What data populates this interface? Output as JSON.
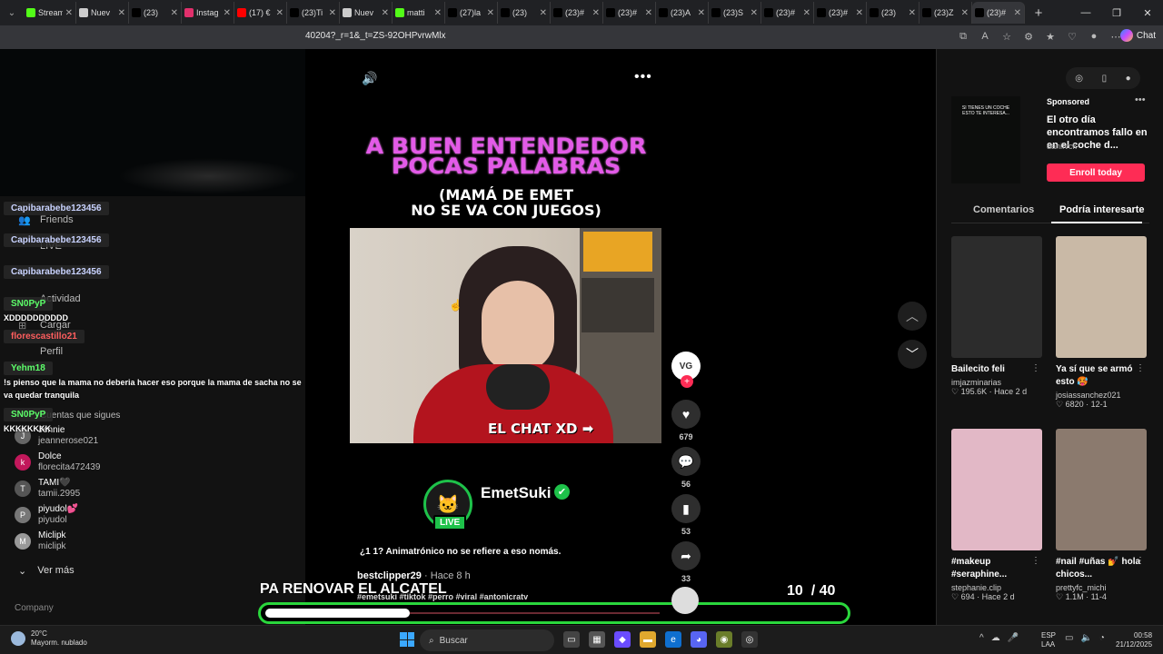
{
  "browser": {
    "tabs": [
      {
        "label": "Stream",
        "color": "#53fc18"
      },
      {
        "label": "Nuev",
        "color": "#cccccc"
      },
      {
        "label": "(23)",
        "color": "#000000"
      },
      {
        "label": "Instag",
        "color": "#e1306c"
      },
      {
        "label": "(17) €",
        "color": "#ff0000"
      },
      {
        "label": "(23)Ti",
        "color": "#000000"
      },
      {
        "label": "Nuev",
        "color": "#cccccc"
      },
      {
        "label": "matti",
        "color": "#53fc18"
      },
      {
        "label": "(27)la",
        "color": "#000000"
      },
      {
        "label": "(23)",
        "color": "#000000"
      },
      {
        "label": "(23)#",
        "color": "#000000"
      },
      {
        "label": "(23)#",
        "color": "#000000"
      },
      {
        "label": "(23)A",
        "color": "#000000"
      },
      {
        "label": "(23)S",
        "color": "#000000"
      },
      {
        "label": "(23)#",
        "color": "#000000"
      },
      {
        "label": "(23)#",
        "color": "#000000"
      },
      {
        "label": "(23)",
        "color": "#000000"
      },
      {
        "label": "(23)Z",
        "color": "#000000"
      },
      {
        "label": "(23)#",
        "color": "#000000"
      }
    ],
    "url": "40204?_r=1&_t=ZS-92OHPvrwMlx",
    "chat_label": "Chat"
  },
  "left": {
    "nav": {
      "friends": "Friends",
      "live": "LIVE",
      "activity": "Actividad",
      "upload": "Cargar",
      "profile": "Perfil",
      "following_heading": "Cuentas que sigues"
    },
    "following": [
      {
        "name": "Jennie",
        "handle": "jeannerose021",
        "initial": "J",
        "color": "#666666"
      },
      {
        "name": "Dolce",
        "handle": "florecita472439",
        "initial": "k",
        "color": "#c2185b"
      },
      {
        "name": "TAMI🖤",
        "handle": "tamii.2995",
        "initial": "T",
        "color": "#555555"
      },
      {
        "name": "piyudol💕",
        "handle": "piyudol",
        "initial": "P",
        "color": "#777777"
      },
      {
        "name": "Miclipk",
        "handle": "miclipk",
        "initial": "M",
        "color": "#999999"
      }
    ],
    "see_more": "Ver más",
    "company": "Company"
  },
  "chat": [
    {
      "name": "Capibarabebe123456",
      "style": "gray",
      "message": ""
    },
    {
      "name": "Capibarabebe123456",
      "style": "gray",
      "message": ""
    },
    {
      "name": "Capibarabebe123456",
      "style": "gray",
      "message": ""
    },
    {
      "name": "SN0PyP",
      "style": "green",
      "message": "XDDDDDDDDDD"
    },
    {
      "name": "florescastillo21",
      "style": "red",
      "message": ""
    },
    {
      "name": "Yehm18",
      "style": "green",
      "message": "!s pienso que la mama no deberia hacer eso porque la mama de sacha no se va quedar tranquila"
    },
    {
      "name": "SN0PyP",
      "style": "green",
      "message": "KKKKKKKK"
    }
  ],
  "video": {
    "title_line1": "A BUEN ENTENDEDOR",
    "title_line2": "POCAS PALABRAS",
    "subtitle_line1": "(MAMÁ DE EMET",
    "subtitle_line2": "NO SE VA CON JUEGOS)",
    "overlay_chat": "EL CHAT XD ➡",
    "streamer_name": "EmetSuki",
    "live_label": "LIVE",
    "caption": "¿1 1? Animatrónico no se refiere a eso nomás.",
    "author": "bestclipper29",
    "time": " · Hace 8 h",
    "hashtags": "#emetsuki #tiktok #perro #viral #antonicratv",
    "bottom_text": "PA RENOVAR EL ALCATEL",
    "counter_current": "10",
    "counter_total": "/ 40",
    "progress": 0.25,
    "avatar_text": "VG"
  },
  "actions": {
    "likes": "679",
    "comments": "56",
    "saves": "53",
    "shares": "33"
  },
  "right": {
    "sponsored": "Sponsored",
    "ad_title": "El otro día encontramos fallo en en el coche d...",
    "ad_handle": "danifvck",
    "ad_thumb_text": "SI TIENES UN COCHE ESTO TE INTERESA...",
    "enroll": "Enroll today",
    "tab_comments": "Comentarios",
    "tab_interest": "Podría interesarte",
    "cards": [
      {
        "title": "Bailecito feli",
        "author": "imjazminarias",
        "meta": "♡ 195.6K · Hace 2 d",
        "color": "#2c2c2c"
      },
      {
        "title": "Ya sí que se armó esto 🥵",
        "author": "josiassanchez021",
        "meta": "♡ 6820 · 12-1",
        "color": "#c9b9a6"
      },
      {
        "title": "#makeup #seraphine...",
        "author": "stephanie.clip",
        "meta": "♡ 694 · Hace 2 d",
        "color": "#e2b8c6"
      },
      {
        "title": "#nail #uñas 💅 hola chicos...",
        "author": "prettyfc_michi",
        "meta": "♡ 1.1M · 11-4",
        "color": "#8b7a6e"
      }
    ]
  },
  "taskbar": {
    "temp": "20°C",
    "weather": "Mayorm. nublado",
    "search": "Buscar",
    "lang1": "ESP",
    "lang2": "LAA",
    "time": "00:58",
    "date": "21/12/2025"
  }
}
